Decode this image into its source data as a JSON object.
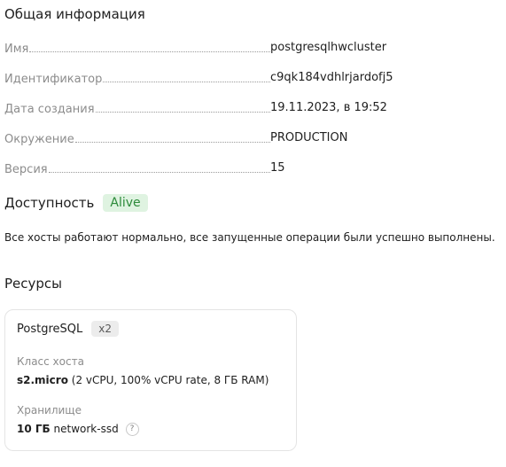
{
  "general": {
    "title": "Общая информация",
    "rows": [
      {
        "label": "Имя",
        "value": "postgresqlhwcluster"
      },
      {
        "label": "Идентификатор",
        "value": "c9qk184vdhlrjardofj5"
      },
      {
        "label": "Дата создания",
        "value": "19.11.2023, в 19:52"
      },
      {
        "label": "Окружение",
        "value": "PRODUCTION"
      },
      {
        "label": "Версия",
        "value": "15"
      }
    ]
  },
  "availability": {
    "title": "Доступность",
    "status": "Alive",
    "status_color": "#2c8a3a",
    "description": "Все хосты работают нормально, все запущенные операции были успешно выполнены."
  },
  "resources": {
    "title": "Ресурсы",
    "card": {
      "db_name": "PostgreSQL",
      "host_count": "x2",
      "host_class_label": "Класс хоста",
      "host_class_name": "s2.micro",
      "host_class_details": "(2 vCPU, 100% vCPU rate, 8 ГБ RAM)",
      "storage_label": "Хранилище",
      "storage_size": "10 ГБ",
      "storage_type": "network-ssd",
      "help_icon": "question-icon"
    }
  }
}
